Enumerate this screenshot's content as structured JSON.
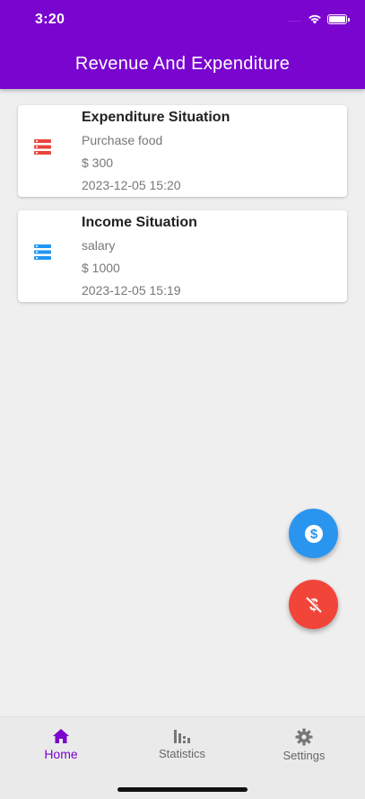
{
  "status_bar": {
    "time": "3:20",
    "signal_dots": "....."
  },
  "header": {
    "title": "Revenue And Expenditure"
  },
  "records": [
    {
      "title": "Expenditure Situation",
      "description": "Purchase food",
      "amount": "$ 300",
      "datetime": "2023-12-05 15:20",
      "icon": "list-icon",
      "icon_color": "#e8453c"
    },
    {
      "title": "Income Situation",
      "description": "salary",
      "amount": "$ 1000",
      "datetime": "2023-12-05 15:19",
      "icon": "list-icon",
      "icon_color": "#2196f3"
    }
  ],
  "fab": {
    "income_icon": "dollar-icon",
    "income_color": "#2a95ee",
    "expense_icon": "money-off-icon",
    "expense_color": "#f2453a"
  },
  "bottom_nav": {
    "items": [
      {
        "label": "Home",
        "icon": "home-icon",
        "active": true
      },
      {
        "label": "Statistics",
        "icon": "bar-chart-icon",
        "active": false
      },
      {
        "label": "Settings",
        "icon": "gear-icon",
        "active": false
      }
    ],
    "active_color": "#7a05cf"
  },
  "colors": {
    "primary": "#7a05cf",
    "background": "#efefef"
  }
}
